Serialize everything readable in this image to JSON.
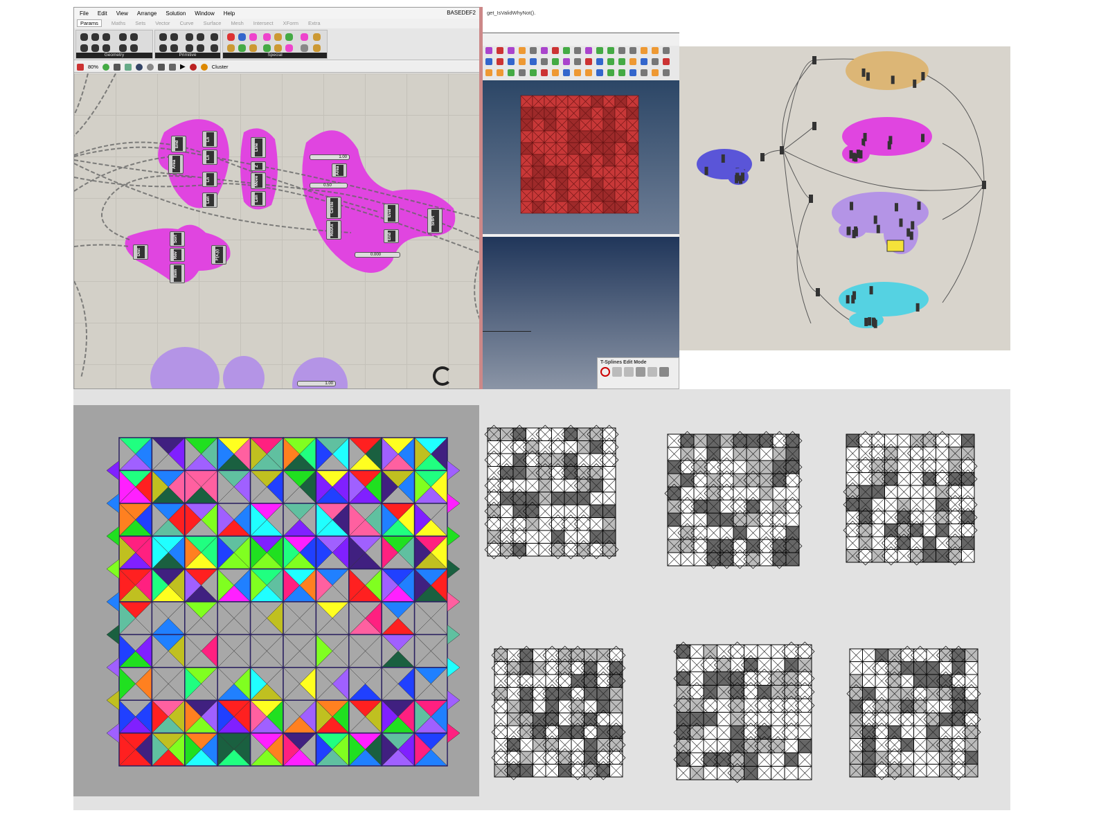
{
  "grasshopper": {
    "title": "BASEDEF2",
    "menu": [
      "File",
      "Edit",
      "View",
      "Arrange",
      "Solution",
      "Window",
      "Help"
    ],
    "tabs": [
      "Params",
      "Maths",
      "Sets",
      "Vector",
      "Curve",
      "Surface",
      "Mesh",
      "Intersect",
      "XForm",
      "Extra"
    ],
    "ribbon_groups": [
      "Geometry",
      "Primitive",
      "Special"
    ],
    "zoom": "80%",
    "cluster_label": "Cluster",
    "nodes": {
      "end": "End",
      "area": "Area",
      "ln1": "Ln",
      "ln2": "Ln",
      "ln3": "Ln",
      "len": "Len",
      "line": "Line",
      "z": "Z",
      "move": "Move",
      "len2": "Len",
      "dist": "Dist",
      "sort": "Sort",
      "rev": "Rev",
      "item": "Item",
      "fxy": "F(x,y)",
      "area2": "Area",
      "circle": "Circle",
      "rotax": "RotAx",
      "eval": "Eval",
      "end2": "End",
      "srfpt": "SrfPt"
    },
    "sliders": {
      "s1": "1.00",
      "s2": "0.50",
      "s3": "0.000",
      "s4": "1.00"
    }
  },
  "rhino": {
    "code_text": "get_IsValidWhyNot().",
    "tsplines_title": "T-Splines Edit Mode"
  },
  "colors": {
    "cluster_magenta": "#e045e0",
    "cluster_lavender": "#b494e6",
    "cluster_tan": "#dcb676",
    "cluster_blue": "#5a55d8",
    "cluster_cyan": "#55d2e2",
    "palette": [
      "#ff2020",
      "#20e020",
      "#2040ff",
      "#ffff20",
      "#ff20ff",
      "#20ffff",
      "#ff8020",
      "#80ff20",
      "#8020ff",
      "#ff2080",
      "#20ff80",
      "#2080ff",
      "#c0c020",
      "#a060ff",
      "#ff60a0",
      "#60c0a0",
      "#1a6040",
      "#402080"
    ]
  }
}
